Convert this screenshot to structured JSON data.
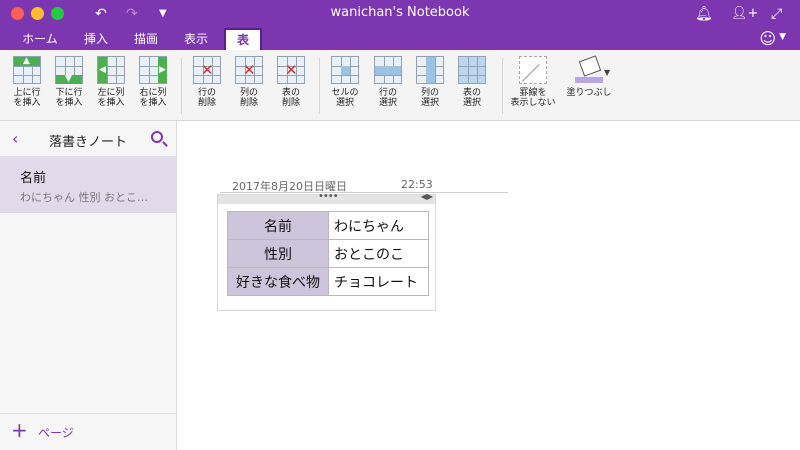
{
  "window": {
    "title": "wanichan's Notebook"
  },
  "tabs": [
    {
      "label": "ホーム"
    },
    {
      "label": "挿入"
    },
    {
      "label": "描画"
    },
    {
      "label": "表示"
    },
    {
      "label": "表"
    }
  ],
  "ribbon": {
    "insert_above": "上に行\nを挿入",
    "insert_below": "下に行\nを挿入",
    "insert_left": "左に列\nを挿入",
    "insert_right": "右に列\nを挿入",
    "delete_row": "行の\n削除",
    "delete_col": "列の\n削除",
    "delete_table": "表の\n削除",
    "select_cell": "セルの\n選択",
    "select_row": "行の\n選択",
    "select_col": "列の\n選択",
    "select_table": "表の\n選択",
    "hide_borders": "罫線を\n表示しない",
    "shading": "塗りつぶし"
  },
  "sidebar": {
    "title": "落書きノート",
    "page": {
      "title": "名前",
      "preview": "わにちゃん  性別  おとこ…"
    },
    "add_page": "ページ"
  },
  "note": {
    "date": "2017年8月20日日曜日",
    "time": "22:53",
    "rows": [
      {
        "key": "名前",
        "value": "わにちゃん"
      },
      {
        "key": "性別",
        "value": "おとこのこ"
      },
      {
        "key": "好きな食べ物",
        "value": "チョコレート"
      }
    ]
  },
  "colors": {
    "accent": "#7B36B0",
    "header_cell": "#CDC5DC",
    "selected_page": "#E2DAEA"
  }
}
